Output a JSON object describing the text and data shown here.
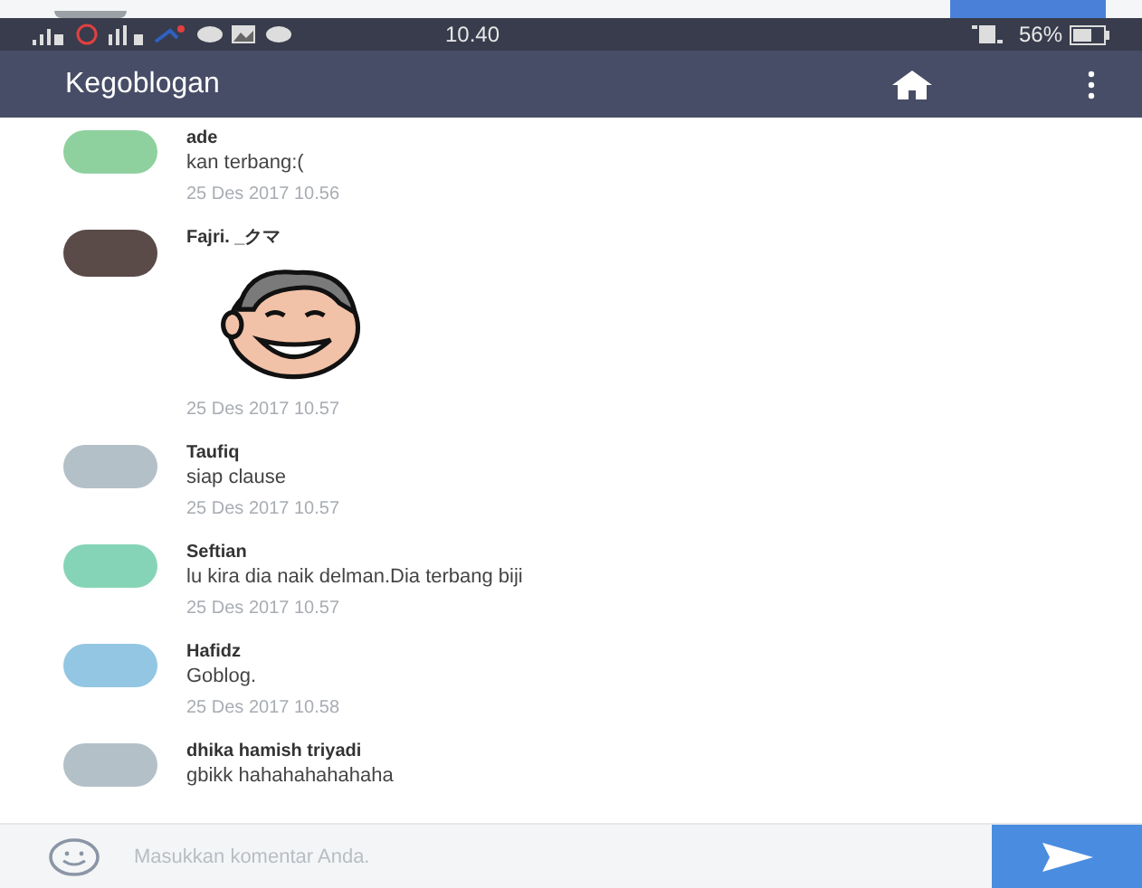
{
  "status_bar": {
    "time": "10.40",
    "battery": "56%"
  },
  "app_bar": {
    "title": "Kegoblogan"
  },
  "comments": [
    {
      "kind": "text",
      "author": "ade",
      "text": "kan terbang:(",
      "date": "25 Des 2017 10.56",
      "avatar": {
        "kind": "plain"
      },
      "color": "#8fd19e"
    },
    {
      "kind": "sticker",
      "author": "Fajri. _クマ",
      "date": "25 Des 2017 10.57",
      "avatar": {
        "kind": "photo"
      },
      "color": "#5a4a48"
    },
    {
      "kind": "text",
      "author": "Taufiq",
      "text": "siap clause",
      "date": "25 Des 2017 10.57",
      "avatar": {
        "kind": "plain"
      },
      "color": "#b3c0c8"
    },
    {
      "kind": "text",
      "author": "Seftian",
      "text": "lu kira dia naik delman.Dia terbang biji",
      "date": "25 Des 2017 10.57",
      "avatar": {
        "kind": "plain"
      },
      "color": "#86d4b8"
    },
    {
      "kind": "text",
      "author": "Hafidz",
      "text": "Goblog.",
      "date": "25 Des 2017 10.58",
      "avatar": {
        "kind": "plain"
      },
      "color": "#92c6e2"
    },
    {
      "kind": "text",
      "author": "dhika hamish triyadi",
      "text": "gbikk hahahahahahaha",
      "avatar": {
        "kind": "plain"
      },
      "color": "#b3c0c8"
    }
  ],
  "input": {
    "placeholder": "Masukkan komentar Anda."
  }
}
